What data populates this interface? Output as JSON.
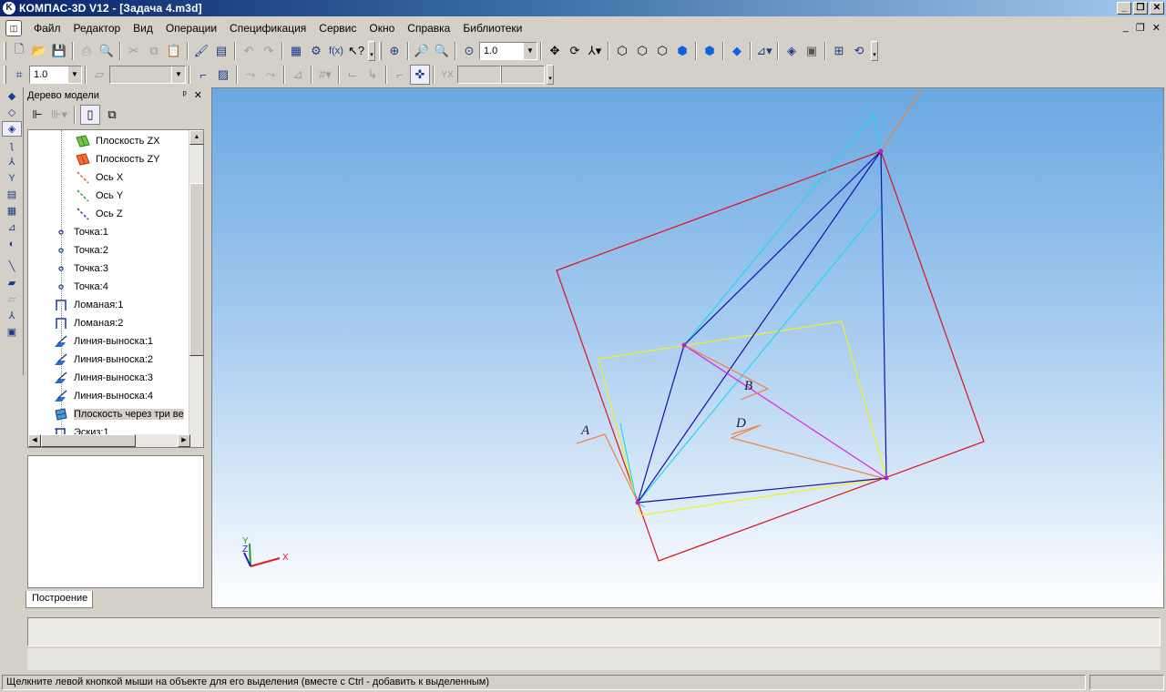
{
  "window": {
    "title": "КОМПАС-3D V12 - [Задача 4.m3d]",
    "icon": "kompas-logo-icon",
    "controls": [
      "minimize",
      "restore",
      "close"
    ]
  },
  "menu": {
    "items": [
      {
        "label": "Файл"
      },
      {
        "label": "Редактор"
      },
      {
        "label": "Вид"
      },
      {
        "label": "Операции"
      },
      {
        "label": "Спецификация"
      },
      {
        "label": "Сервис"
      },
      {
        "label": "Окно"
      },
      {
        "label": "Справка"
      },
      {
        "label": "Библиотеки"
      }
    ]
  },
  "toolbar_main": {
    "zoom_value": "1.0"
  },
  "toolbar_secondary": {
    "step_value": "1.0"
  },
  "tree_panel": {
    "title": "Дерево модели",
    "pin_glyph": "ᵖ",
    "close_glyph": "✕",
    "items": [
      {
        "label": "Плоскость ZX",
        "icon": "plane-zx-icon"
      },
      {
        "label": "Плоскость ZY",
        "icon": "plane-zy-icon"
      },
      {
        "label": "Ось X",
        "icon": "axis-x-icon"
      },
      {
        "label": "Ось Y",
        "icon": "axis-y-icon"
      },
      {
        "label": "Ось Z",
        "icon": "axis-z-icon"
      },
      {
        "label": "Точка:1",
        "icon": "point-icon"
      },
      {
        "label": "Точка:2",
        "icon": "point-icon"
      },
      {
        "label": "Точка:3",
        "icon": "point-icon"
      },
      {
        "label": "Точка:4",
        "icon": "point-icon"
      },
      {
        "label": "Ломаная:1",
        "icon": "polyline-icon"
      },
      {
        "label": "Ломаная:2",
        "icon": "polyline-icon"
      },
      {
        "label": "Линия-выноска:1",
        "icon": "leader-line-icon"
      },
      {
        "label": "Линия-выноска:2",
        "icon": "leader-line-icon"
      },
      {
        "label": "Линия-выноска:3",
        "icon": "leader-line-icon"
      },
      {
        "label": "Линия-выноска:4",
        "icon": "leader-line-icon"
      },
      {
        "label": "Плоскость через три ве",
        "icon": "plane-three-points-icon",
        "selected": true
      },
      {
        "label": "Эскиз:1",
        "icon": "sketch-icon"
      }
    ],
    "tab_label": "Построение"
  },
  "viewport": {
    "labels": {
      "a": "A",
      "b": "B",
      "d": "D"
    },
    "axis_labels": {
      "x": "X",
      "y": "Y",
      "z": "Z"
    },
    "colors": {
      "background_top": "#6aa8e2",
      "background_bottom": "#ffffff",
      "plane_red": "#e0101c",
      "plane_yellow": "#f0f020",
      "edges_blue": "#1010b0",
      "edges_cyan": "#20d8f0",
      "edge_magenta": "#e020e0",
      "leader_orange": "#f08040"
    }
  },
  "status": {
    "message": "Щелкните левой кнопкой мыши на объекте для его выделения (вместе с Ctrl - добавить к выделенным)"
  }
}
